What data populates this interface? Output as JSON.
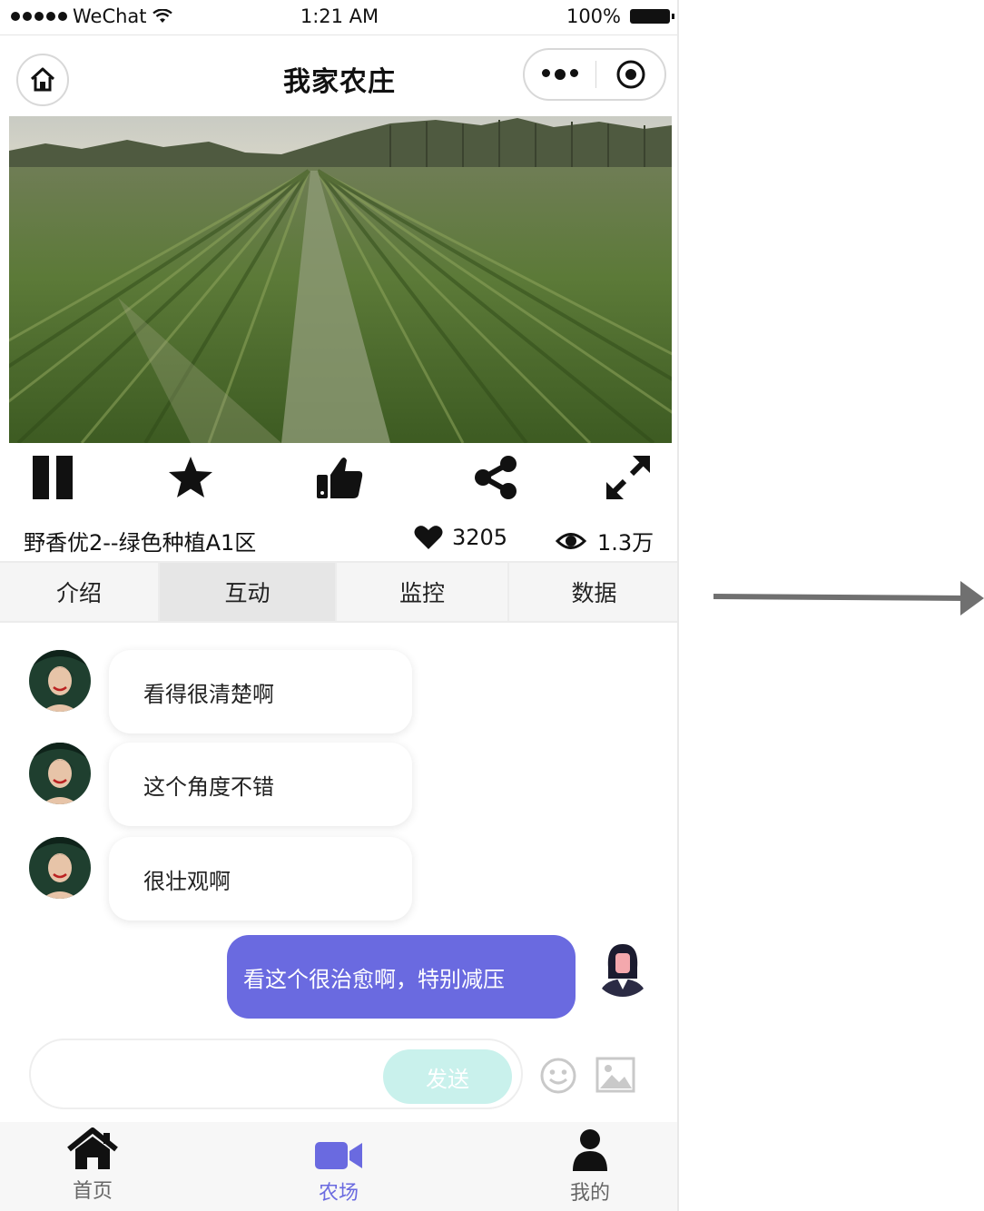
{
  "status_bar": {
    "carrier": "WeChat",
    "time": "1:21 AM",
    "battery": "100%"
  },
  "nav": {
    "title": "我家农庄"
  },
  "video": {
    "image_desc_icon": "rice-field-video"
  },
  "controls": [
    "pause-icon",
    "star-icon",
    "thumbs-up-icon",
    "share-icon",
    "fullscreen-icon"
  ],
  "info": {
    "title": "野香优2--绿色种植A1区",
    "likes": "3205",
    "views": "1.3万"
  },
  "tabs": [
    {
      "label": "介绍"
    },
    {
      "label": "互动"
    },
    {
      "label": "监控"
    },
    {
      "label": "数据"
    }
  ],
  "chat": {
    "messages": [
      {
        "text": "看得很清楚啊"
      },
      {
        "text": "这个角度不错"
      },
      {
        "text": "很壮观啊"
      },
      {
        "text": "看这个很治愈啊，特别减压"
      }
    ]
  },
  "composer": {
    "placeholder": "",
    "send_label": "发送"
  },
  "tabbar": {
    "items": [
      {
        "label": "首页"
      },
      {
        "label": "农场"
      },
      {
        "label": "我的"
      }
    ]
  },
  "colors": {
    "accent": "#6a6ae0",
    "send_button": "#c9f1ec"
  }
}
